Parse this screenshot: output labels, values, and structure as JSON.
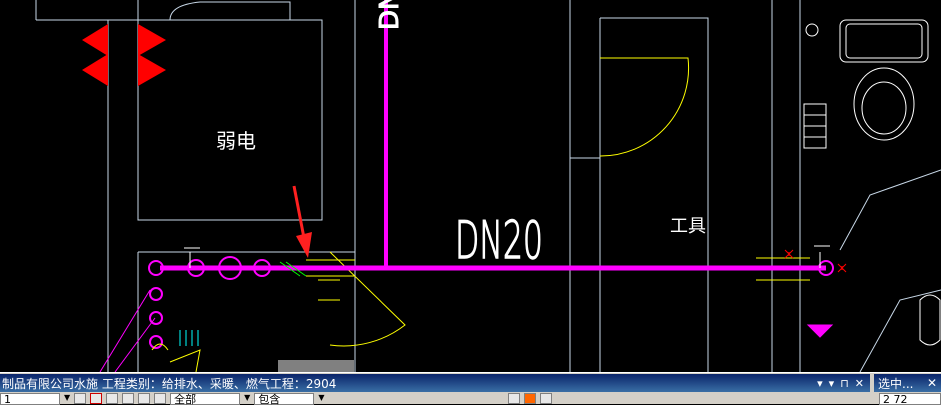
{
  "drawing": {
    "room_label_weak_current": "弱电",
    "pipe_label": "DN20",
    "room_label_tools": "工具",
    "vertical_pipe_label": "DN",
    "colors": {
      "background": "#000000",
      "pipe": "#ff00ff",
      "wall": "#c8d8e8",
      "door": "#ffff00",
      "marker": "#ff0000",
      "arrow": "#ff2020"
    }
  },
  "status_bar": {
    "title": "制品有限公司水施  工程类别：给排水、采暖、燃气工程：2904",
    "side_title": "选中...",
    "field_value": "1",
    "layer_all": "全部",
    "include_label": "包含",
    "side_value": "2  72"
  },
  "icons": [
    "dropdown-arrow-icon",
    "pin-icon",
    "close-icon",
    "arrow-red-icon"
  ]
}
